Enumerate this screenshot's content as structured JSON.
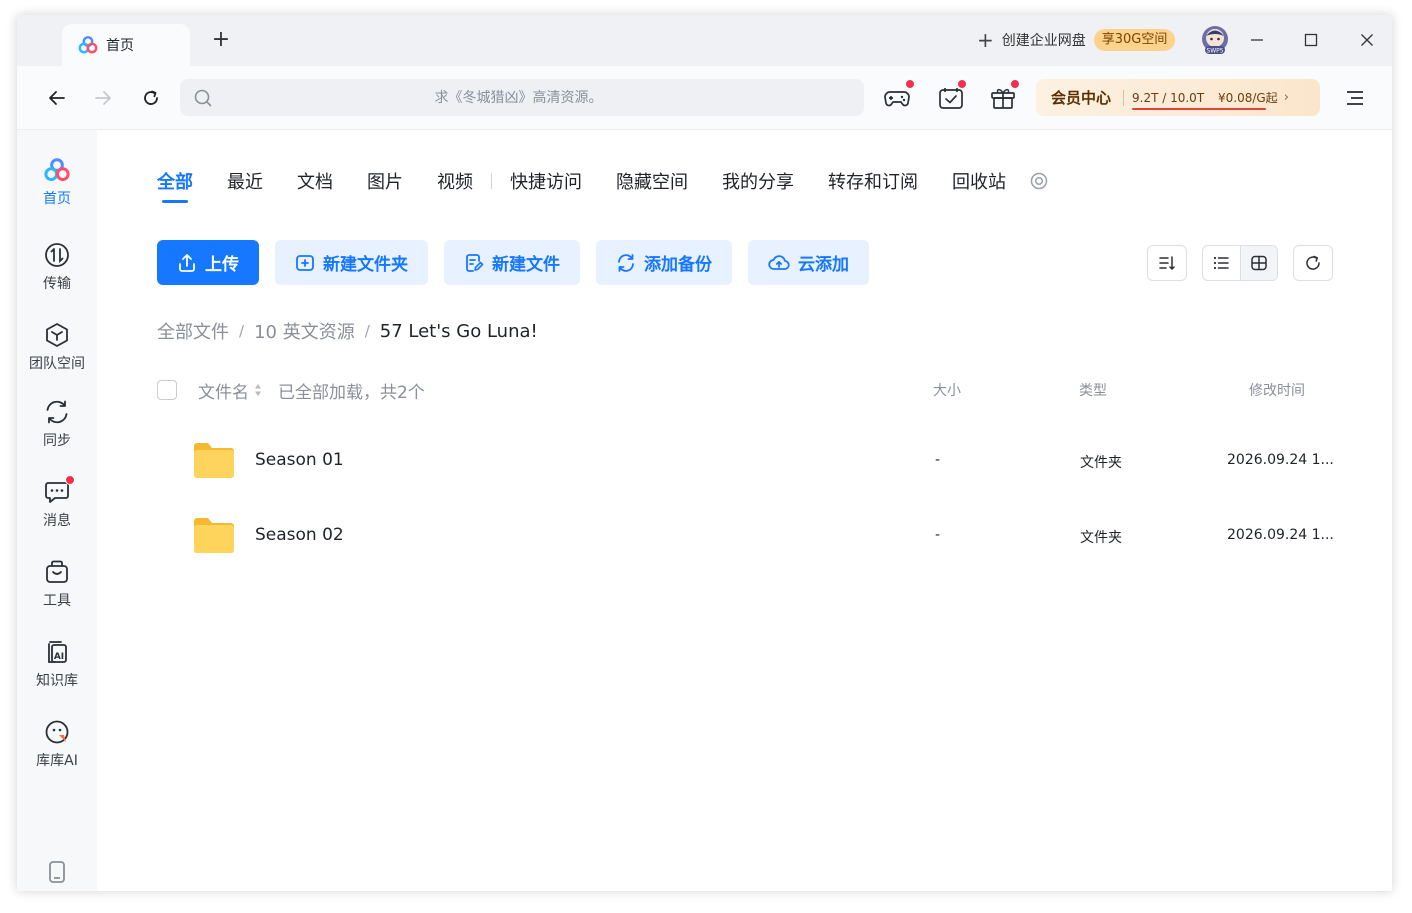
{
  "titlebar": {
    "tab_label": "首页",
    "new_tab": "+",
    "enterprise_label": "创建企业网盘",
    "enterprise_badge": "享30G空间",
    "avatar_badge": "SWP5"
  },
  "toolbar": {
    "search_placeholder": "求《冬城猎凶》高清资源。",
    "vip_title": "会员中心",
    "vip_storage": "9.2T / 10.0T",
    "vip_price": "¥0.08/G起",
    "vip_storage_used_fraction": 0.92
  },
  "sidebar": {
    "items": [
      {
        "label": "首页",
        "icon": "home-logo-icon"
      },
      {
        "label": "传输",
        "icon": "transfer-icon"
      },
      {
        "label": "团队空间",
        "icon": "team-space-icon"
      },
      {
        "label": "同步",
        "icon": "sync-icon"
      },
      {
        "label": "消息",
        "icon": "message-icon"
      },
      {
        "label": "工具",
        "icon": "tools-icon"
      },
      {
        "label": "知识库",
        "icon": "knowledge-base-icon"
      },
      {
        "label": "库库AI",
        "icon": "ai-assistant-icon"
      }
    ]
  },
  "main": {
    "tabs": [
      "全部",
      "最近",
      "文档",
      "图片",
      "视频",
      "快捷访问",
      "隐藏空间",
      "我的分享",
      "转存和订阅",
      "回收站"
    ],
    "actions": [
      "上传",
      "新建文件夹",
      "新建文件",
      "添加备份",
      "云添加"
    ],
    "breadcrumb": [
      "全部文件",
      "10 英文资源",
      "57 Let's Go Luna!"
    ],
    "list_header": {
      "name": "文件名",
      "loaded": "已全部加载，共2个",
      "size": "大小",
      "type": "类型",
      "modified": "修改时间"
    },
    "files": [
      {
        "name": "Season 01",
        "size": "-",
        "type": "文件夹",
        "modified": "2026.09.24 1..."
      },
      {
        "name": "Season 02",
        "size": "-",
        "type": "文件夹",
        "modified": "2026.09.24 1..."
      }
    ]
  },
  "colors": {
    "accent": "#1677ff",
    "accent_light": "#e8f1ff",
    "notification": "#f2304d",
    "folder": "#ffc94a",
    "vip_text": "#5a2e00"
  }
}
